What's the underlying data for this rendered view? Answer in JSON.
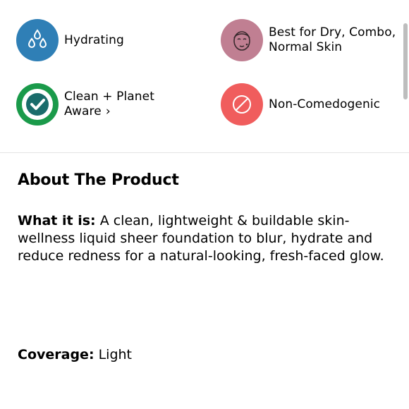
{
  "highlights": [
    {
      "icon": "water-drops-icon",
      "label": "Hydrating",
      "color": "#2f7fb6"
    },
    {
      "icon": "face-icon",
      "label": "Best for Dry, Combo, Normal Skin",
      "color": "#c07f92"
    },
    {
      "icon": "checkmark-icon",
      "label": "Clean + Planet Aware",
      "chevron": "›",
      "color": "#1a9a4a"
    },
    {
      "icon": "prohibited-icon",
      "label": "Non-Comedogenic",
      "color": "#f05d5d"
    }
  ],
  "about": {
    "heading": "About The Product",
    "what_it_is_label": "What it is:",
    "what_it_is_text": "A clean, lightweight & buildable skin-wellness liquid sheer foundation to blur, hydrate and reduce redness for a natural-looking, fresh-faced glow.",
    "coverage_label": "Coverage:",
    "coverage_text": "Light"
  }
}
